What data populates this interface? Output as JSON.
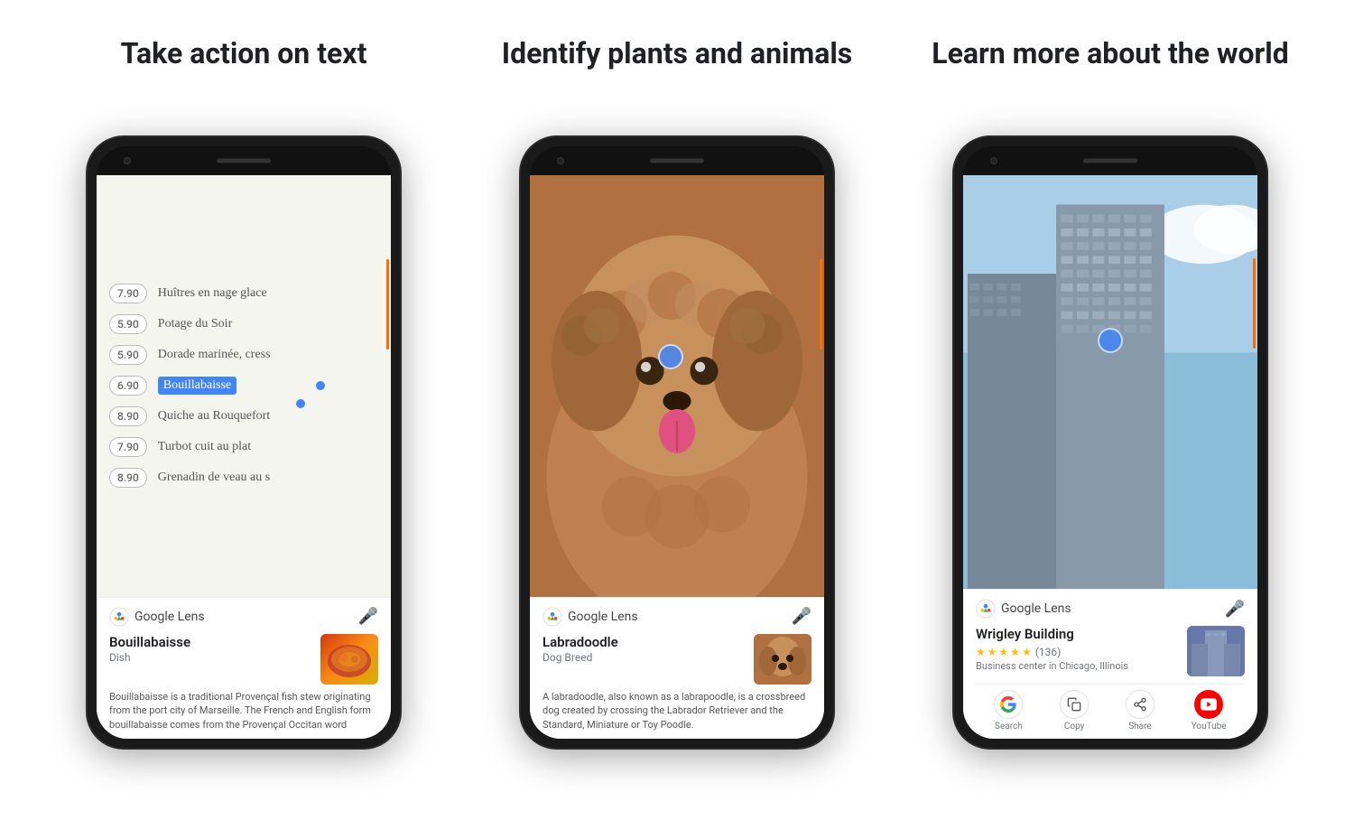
{
  "columns": [
    {
      "id": "col1",
      "title": "Take action on text",
      "phone": {
        "type": "menu",
        "menu_items": [
          {
            "price": "7.90",
            "text": "Huîtres en nage glace"
          },
          {
            "price": "5.90",
            "text": "Potage du Soir"
          },
          {
            "price": "5.90",
            "text": "Dorade marinée, cress"
          },
          {
            "price": "6.90",
            "text": "Bouillabaisse",
            "selected": true
          },
          {
            "price": "8.90",
            "text": "Quiche au Rouquefort"
          },
          {
            "price": "7.90",
            "text": "Turbot cuit au plat"
          },
          {
            "price": "8.90",
            "text": "Grenadin de veau au s"
          }
        ],
        "lens_title": "Bouillabaisse",
        "lens_subtitle": "Dish",
        "lens_desc": "Bouillabaisse is a traditional Provençal fish stew originating from the port city of Marseille. The French and English form bouillabaisse comes from the Provençal Occitan word",
        "has_actions": false
      }
    },
    {
      "id": "col2",
      "title": "Identify plants and animals",
      "phone": {
        "type": "dog",
        "lens_title": "Labradoodle",
        "lens_subtitle": "Dog Breed",
        "lens_desc": "A labradoodle, also known as a labrapoodle, is a crossbreed dog created by crossing the Labrador Retriever and the Standard, Miniature or Toy Poodle.",
        "has_actions": false
      }
    },
    {
      "id": "col3",
      "title": "Learn more about the world",
      "phone": {
        "type": "building",
        "lens_title": "Wrigley Building",
        "lens_subtitle": "Business center in Chicago, Illinois",
        "lens_rating": "4.5",
        "lens_review_count": "(136)",
        "has_actions": true,
        "actions": [
          {
            "id": "search",
            "label": "Search",
            "type": "google"
          },
          {
            "id": "copy",
            "label": "Copy",
            "type": "copy"
          },
          {
            "id": "share",
            "label": "Share",
            "type": "share"
          },
          {
            "id": "youtube",
            "label": "YouTube",
            "type": "youtube"
          }
        ]
      }
    }
  ],
  "google_lens_label": "Google Lens",
  "mic_symbol": "🎤",
  "stars_full": "★★★★",
  "star_half": "½"
}
